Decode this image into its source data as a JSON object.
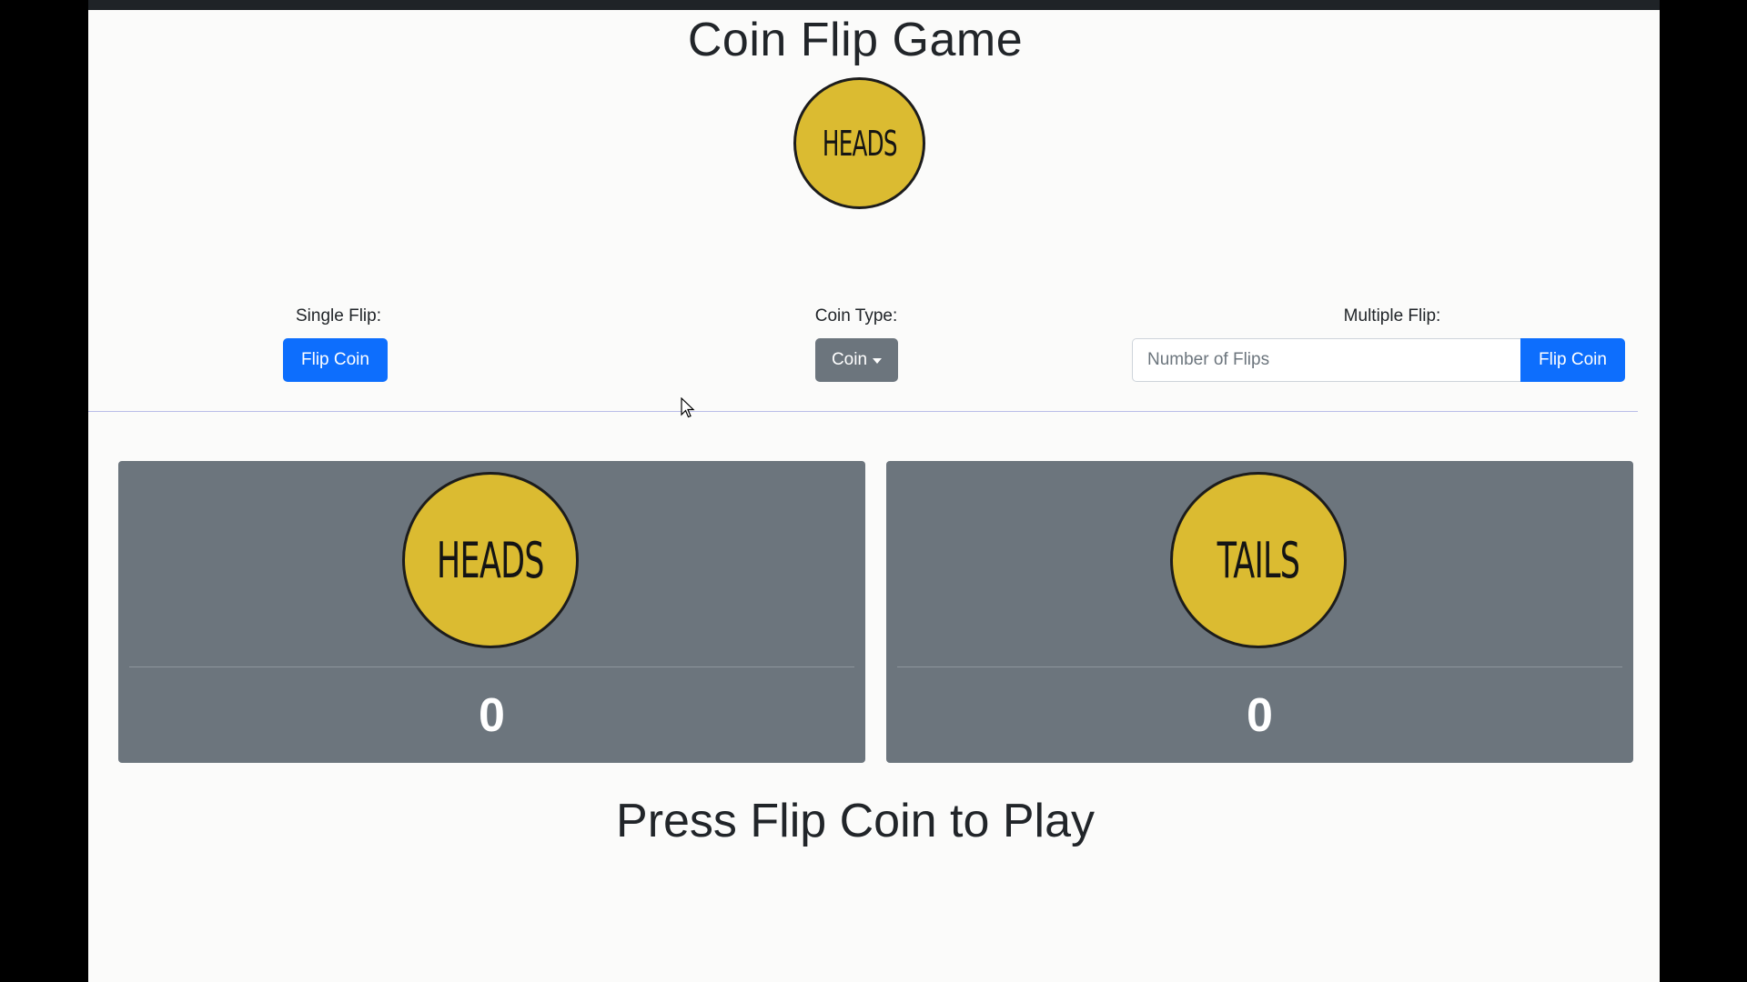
{
  "title": "Coin Flip Game",
  "hero_coin": {
    "face": "HEADS",
    "icon": "coin-icon"
  },
  "controls": {
    "single": {
      "label": "Single Flip:",
      "button": "Flip Coin"
    },
    "coin_type": {
      "label": "Coin Type:",
      "dropdown": "Coin"
    },
    "multiple": {
      "label": "Multiple Flip:",
      "placeholder": "Number of Flips",
      "value": "",
      "button": "Flip Coin"
    }
  },
  "results": [
    {
      "face": "HEADS",
      "count": "0"
    },
    {
      "face": "TAILS",
      "count": "0"
    }
  ],
  "prompt": "Press Flip Coin to Play",
  "colors": {
    "coin": "#dbbb31",
    "primary": "#0d6efd",
    "secondary": "#6c757d",
    "card": "#6c757d"
  }
}
